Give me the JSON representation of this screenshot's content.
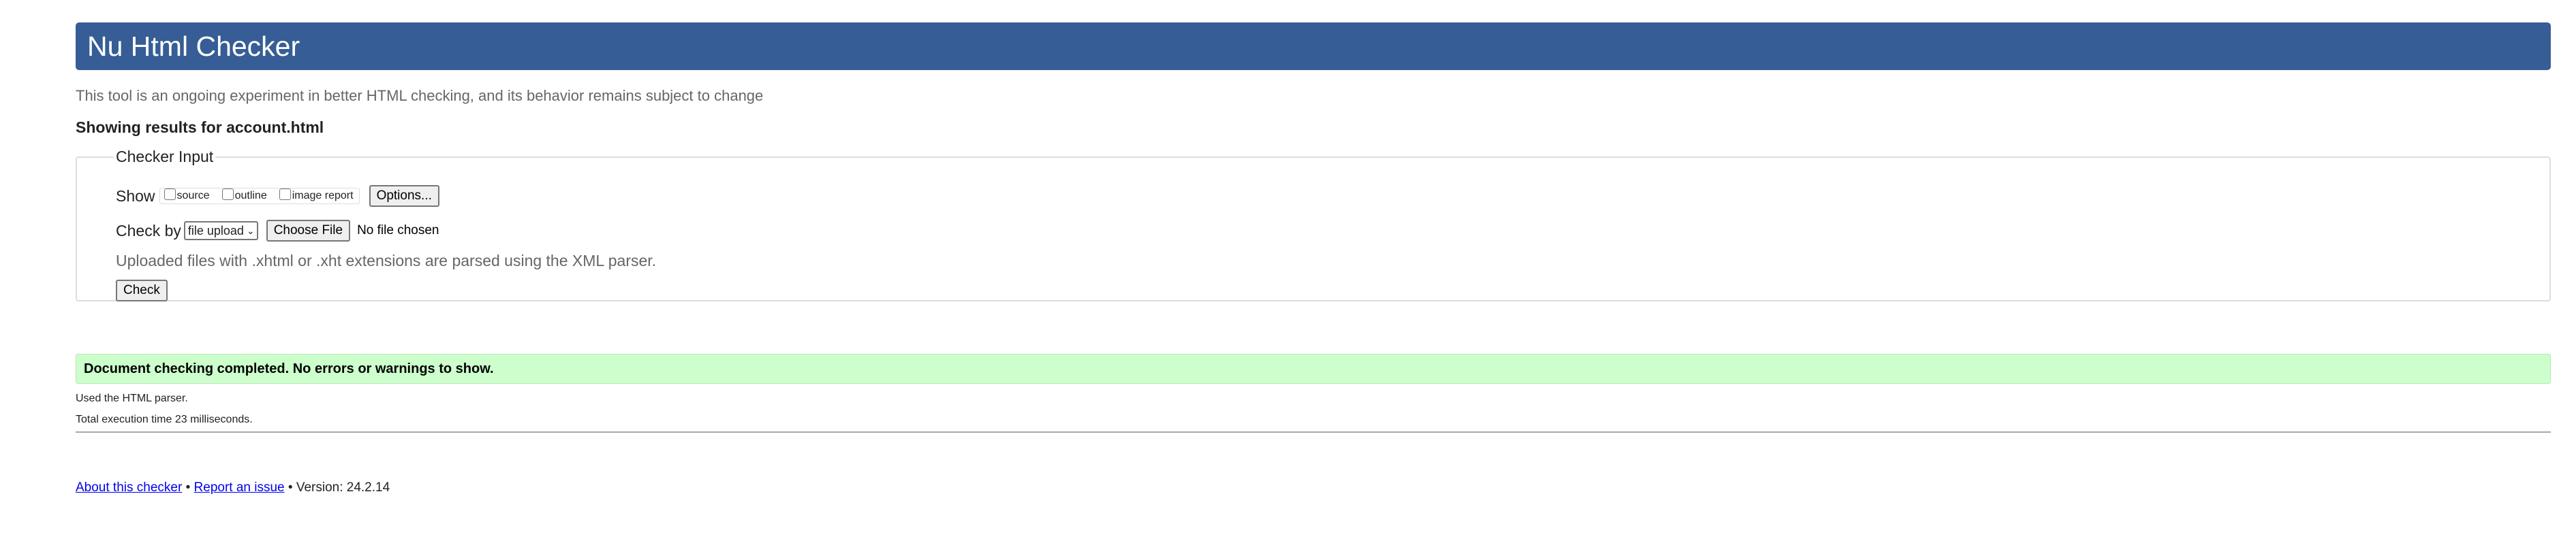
{
  "header": {
    "title": "Nu Html Checker",
    "color": "#365d95"
  },
  "intro": "This tool is an ongoing experiment in better HTML checking, and its behavior remains subject to change",
  "showing_results": "Showing results for account.html",
  "checker_input": {
    "legend": "Checker Input",
    "show_label": "Show",
    "show_options": [
      {
        "label": "source",
        "checked": false
      },
      {
        "label": "outline",
        "checked": false
      },
      {
        "label": "image report",
        "checked": false
      }
    ],
    "options_button": "Options...",
    "check_by_label": "Check by",
    "check_by_select": "file upload",
    "choose_file_button": "Choose File",
    "no_file_text": "No file chosen",
    "xml_note": "Uploaded files with .xhtml or .xht extensions are parsed using the XML parser.",
    "check_button": "Check"
  },
  "results": {
    "success_message": "Document checking completed. No errors or warnings to show.",
    "success_color": "#ccffcc",
    "parser_note": "Used the HTML parser.",
    "execution_note": "Total execution time 23 milliseconds."
  },
  "footer": {
    "about_link": "About this checker",
    "separator": "•",
    "report_link": "Report an issue",
    "version": "Version: 24.2.14"
  }
}
